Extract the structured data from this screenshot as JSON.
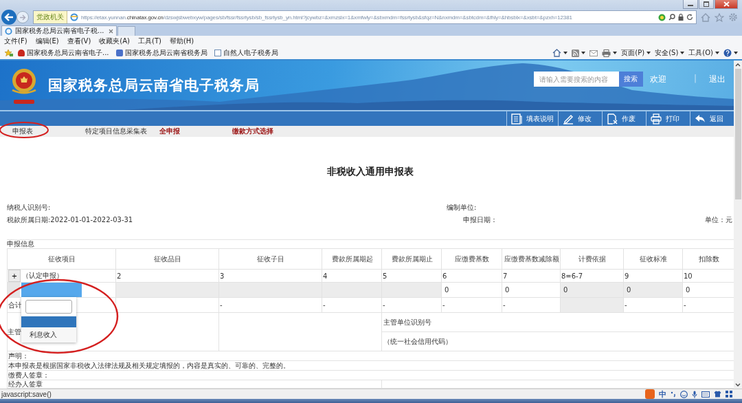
{
  "browser": {
    "zone_label": "党政机关",
    "url_prefix": "https://etax.yunnan.",
    "url_domain": "chinatax.gov.cn",
    "url_path": "/dzswjsbwebxyw/pages/sb/fssr/fssrtysb/sb_fssrtysb_yn.html?jcywbz=&xmzslx=1&xmfwly=&sbxmdm=fssrtysb&sfqz=N&nxmdm=&sbtcdm=&fhly=&hbsblx=&xsbt=&pzxh=12381",
    "tabs": [
      {
        "title": "国家税务总局云南省电子税...",
        "selected": true
      }
    ],
    "menu": [
      "文件(F)",
      "编辑(E)",
      "查看(V)",
      "收藏夹(A)",
      "工具(T)",
      "帮助(H)"
    ],
    "favorites": [
      {
        "label": "国家税务总局云南省电子...",
        "kind": "emblem"
      },
      {
        "label": "国家税务总局云南省税务局",
        "kind": "site"
      },
      {
        "label": "自然人电子税务局",
        "kind": "page"
      }
    ],
    "command_menus": [
      "页面(P)",
      "安全(S)",
      "工具(O)"
    ]
  },
  "site": {
    "title": "国家税务总局云南省电子税务局",
    "search": {
      "placeholder": "请输入需要搜索的内容",
      "button": "搜索"
    },
    "welcome": "欢迎",
    "separator": "|",
    "logout": "退出"
  },
  "toolbar": [
    {
      "label": "填表说明",
      "kind": "guide"
    },
    {
      "label": "修改",
      "kind": "edit"
    },
    {
      "label": "作废",
      "kind": "void"
    },
    {
      "label": "打印",
      "kind": "print"
    },
    {
      "label": "返回",
      "kind": "back"
    }
  ],
  "page_tabs": [
    {
      "label": "申报表",
      "kind": "plain"
    },
    {
      "label": "特定项目信息采集表",
      "kind": "plain"
    },
    {
      "label": "全申报",
      "kind": "emphasis"
    },
    {
      "label": "缴款方式选择",
      "kind": "emphasis"
    }
  ],
  "form": {
    "title": "非税收入通用申报表",
    "taxpayer_id_label": "纳税人识别号:",
    "prepared_by_label": "编制单位:",
    "period": "税款所属日期:2022-01-01-2022-03-31",
    "declare_date_label": "申报日期：",
    "unit": "单位：元",
    "section": "申报信息",
    "columns": [
      "征收项目",
      "征收品目",
      "征收子目",
      "费款所属期起",
      "费款所属期止",
      "应缴费基数",
      "应缴费基数减除额",
      "计费依据",
      "征收标准",
      "扣除数"
    ],
    "index_row": {
      "add_button": "+",
      "first": "（认定申报）",
      "cells": [
        "2",
        "3",
        "4",
        "5",
        "6",
        "7",
        "8=6-7",
        "9",
        "10"
      ]
    },
    "entry_row": [
      {
        "kind": "readonly"
      },
      {
        "kind": "readonly"
      },
      {
        "kind": "readonly"
      },
      {
        "kind": "readonly"
      },
      {
        "kind": "input",
        "value": "0"
      },
      {
        "kind": "input",
        "value": "0"
      },
      {
        "kind": "readonly",
        "value": "0"
      },
      {
        "kind": "readonly",
        "value": "0"
      },
      {
        "kind": "input",
        "value": "0"
      }
    ],
    "total_row": {
      "label": "合计",
      "cells": [
        {
          "kind": "blank"
        },
        {
          "kind": "text",
          "value": "-"
        },
        {
          "kind": "text",
          "value": "-"
        },
        {
          "kind": "text",
          "value": "-"
        },
        {
          "kind": "text",
          "value": "-"
        },
        {
          "kind": "text",
          "value": "-"
        },
        {
          "kind": "readonly"
        },
        {
          "kind": "text",
          "value": "-"
        },
        {
          "kind": "text",
          "value": "-"
        }
      ]
    },
    "supervisor_label": "主管",
    "supervisor_id_label": "主管单位识别号",
    "credit_code_hint": "（统一社会信用代码）",
    "declaration_heading": "声明：",
    "declaration": "本申报表是根据国家非税收入法律法规及相关规定填报的，内容是真实的、可靠的、完整的。",
    "payer_signature": "缴费人签章：",
    "agent_signature": "经办人签章"
  },
  "dropdown": {
    "options": [
      {
        "label": "利息收入",
        "selected": false
      }
    ]
  },
  "status_bar": {
    "text": "javascript:save()"
  },
  "ime": {
    "label": "中"
  }
}
